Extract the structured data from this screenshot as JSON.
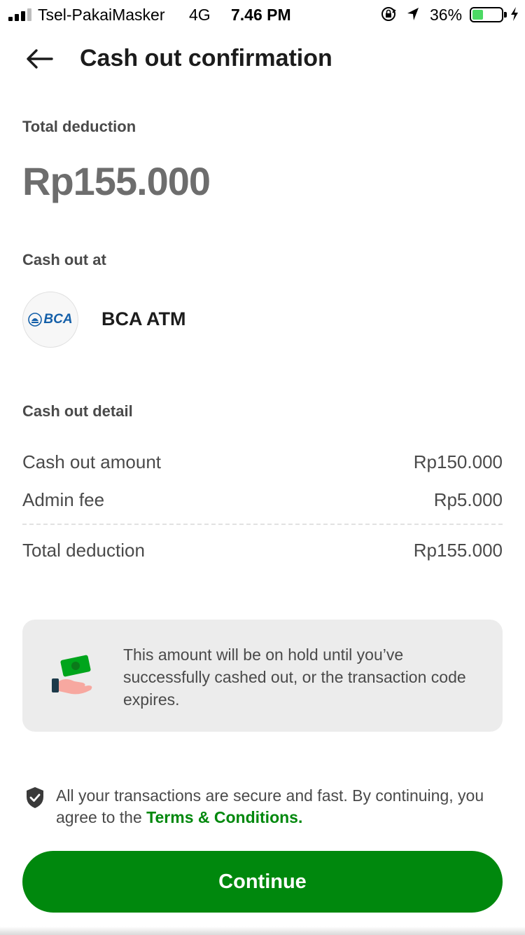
{
  "status_bar": {
    "carrier": "Tsel-PakaiMasker",
    "network": "4G",
    "time": "7.46 PM",
    "battery_pct": "36%",
    "battery_level": 0.36
  },
  "header": {
    "back_icon": "arrow-left-icon",
    "title": "Cash out confirmation"
  },
  "summary": {
    "label": "Total deduction",
    "amount": "Rp155.000"
  },
  "cash_out_at": {
    "label": "Cash out at",
    "logo_text": "BCA",
    "bank_name": "BCA ATM"
  },
  "detail": {
    "label": "Cash out detail",
    "rows": [
      {
        "label": "Cash out amount",
        "value": "Rp150.000"
      },
      {
        "label": "Admin fee",
        "value": "Rp5.000"
      }
    ],
    "total": {
      "label": "Total deduction",
      "value": "Rp155.000"
    }
  },
  "hold_notice": {
    "icon": "hand-money-icon",
    "text": "This amount will be on hold until you’ve successfully cashed out, or the transaction code expires."
  },
  "secure_notice": {
    "icon": "shield-check-icon",
    "text": "All your transactions are secure and fast. By continuing, you agree to the ",
    "link": "Terms & Conditions."
  },
  "continue_button": {
    "label": "Continue"
  },
  "colors": {
    "accent": "#00880d",
    "card_bg": "#ececec",
    "amount_text": "#6d6d6d"
  }
}
